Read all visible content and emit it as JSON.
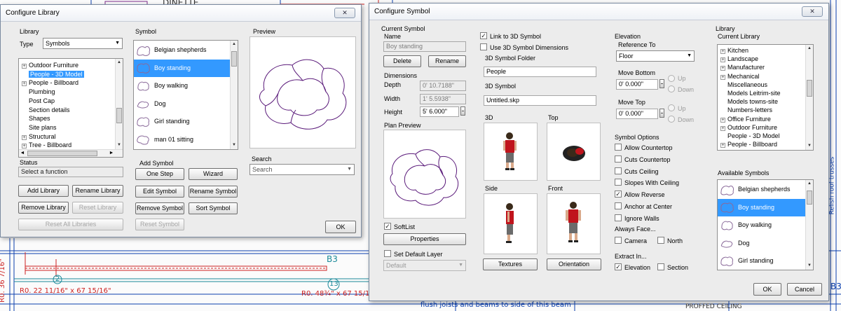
{
  "background": {
    "texts": [
      "DINETTE",
      "flush joists and beams to side of this beam",
      "PROFFED CEILING",
      "B3",
      "B3",
      "R0. 22 11/16\" x 67 15/16\"",
      "R0. 48¾\" x 67 15/16\"",
      "R0. 36 7/16\"",
      "2",
      "13",
      "Relish roof trusses"
    ]
  },
  "library_dialog": {
    "title": "Configure Library",
    "close_label": "✕",
    "library_group_label": "Library",
    "type_label": "Type",
    "type_value": "Symbols",
    "tree_items": [
      {
        "label": "Outdoor Furniture",
        "expander": "+",
        "selected": false
      },
      {
        "label": "People - 3D Model",
        "expander": "",
        "selected": true
      },
      {
        "label": "People - Billboard",
        "expander": "+",
        "selected": false
      },
      {
        "label": "Plumbing",
        "expander": "",
        "selected": false
      },
      {
        "label": "Post Cap",
        "expander": "",
        "selected": false
      },
      {
        "label": "Section details",
        "expander": "",
        "selected": false
      },
      {
        "label": "Shapes",
        "expander": "",
        "selected": false
      },
      {
        "label": "Site plans",
        "expander": "",
        "selected": false
      },
      {
        "label": "Structural",
        "expander": "+",
        "selected": false
      },
      {
        "label": "Tree - Billboard",
        "expander": "+",
        "selected": false
      }
    ],
    "status_label": "Status",
    "status_value": "Select a function",
    "add_library": "Add Library",
    "rename_library": "Rename Library",
    "remove_library": "Remove Library",
    "reset_library": "Reset Library",
    "reset_all_libraries": "Reset All Libraries",
    "symbol_group_label": "Symbol",
    "symbols": [
      "Belgian shepherds",
      "Boy standing",
      "Boy walking",
      "Dog",
      "Girl standing",
      "man 01 sitting"
    ],
    "selected_symbol_index": 1,
    "add_symbol_label": "Add Symbol",
    "one_step": "One Step",
    "wizard": "Wizard",
    "edit_symbol": "Edit Symbol",
    "rename_symbol": "Rename Symbol",
    "remove_symbol": "Remove Symbol",
    "sort_symbol": "Sort Symbol",
    "reset_symbol": "Reset Symbol",
    "preview_label": "Preview",
    "search_label": "Search",
    "search_value": "Search",
    "ok": "OK"
  },
  "symbol_dialog": {
    "title": "Configure Symbol",
    "close_label": "✕",
    "current_symbol_label": "Current Symbol",
    "name_label": "Name",
    "name_value": "Boy standing",
    "delete": "Delete",
    "rename": "Rename",
    "dimensions_label": "Dimensions",
    "depth_label": "Depth",
    "depth_value": "0' 10.7188\"",
    "width_label": "Width",
    "width_value": "1' 5.5938\"",
    "height_label": "Height",
    "height_value": "5' 6.000\"",
    "plan_preview_label": "Plan Preview",
    "softlist_label": "SoftList",
    "softlist_checked": true,
    "properties": "Properties",
    "set_default_layer_label": "Set Default Layer",
    "set_default_layer_checked": false,
    "layer_value": "Default",
    "link_3d_label": "Link to 3D Symbol",
    "link_3d_checked": true,
    "use_3d_dims_label": "Use 3D Symbol Dimensions",
    "use_3d_dims_checked": false,
    "folder_label": "3D Symbol Folder",
    "folder_value": "People",
    "symbol_3d_label": "3D Symbol",
    "symbol_3d_value": "Untitled.skp",
    "view_3d_label": "3D",
    "view_top_label": "Top",
    "view_side_label": "Side",
    "view_front_label": "Front",
    "textures": "Textures",
    "orientation": "Orientation",
    "elevation_label": "Elevation",
    "reference_to_label": "Reference To",
    "reference_value": "Floor",
    "move_bottom_label": "Move Bottom",
    "move_bottom_value": "0' 0.000\"",
    "move_top_label": "Move Top",
    "move_top_value": "0' 0.000\"",
    "up_label": "Up",
    "down_label": "Down",
    "symbol_options_label": "Symbol Options",
    "options": [
      {
        "label": "Allow Countertop",
        "checked": false
      },
      {
        "label": "Cuts Countertop",
        "checked": false
      },
      {
        "label": "Cuts Ceiling",
        "checked": false
      },
      {
        "label": "Slopes With Ceiling",
        "checked": false
      },
      {
        "label": "Allow Reverse",
        "checked": true
      },
      {
        "label": "Anchor at Center",
        "checked": false
      },
      {
        "label": "Ignore Walls",
        "checked": false
      }
    ],
    "always_face_label": "Always Face...",
    "camera_label": "Camera",
    "north_label": "North",
    "extract_in_label": "Extract In...",
    "elevation_chk_label": "Elevation",
    "section_chk_label": "Section",
    "library_label": "Library",
    "current_library_label": "Current Library",
    "library_tree": [
      {
        "label": "Kitchen",
        "expander": "+"
      },
      {
        "label": "Landscape",
        "expander": "+"
      },
      {
        "label": "Manufacturer",
        "expander": "+"
      },
      {
        "label": "Mechanical",
        "expander": "+"
      },
      {
        "label": "Miscellaneous",
        "expander": ""
      },
      {
        "label": "Models Leitrim-site",
        "expander": ""
      },
      {
        "label": "Models towns-site",
        "expander": ""
      },
      {
        "label": "Numbers-letters",
        "expander": ""
      },
      {
        "label": "Office Furniture",
        "expander": "+"
      },
      {
        "label": "Outdoor Furniture",
        "expander": "+"
      },
      {
        "label": "People - 3D Model",
        "expander": ""
      },
      {
        "label": "People - Billboard",
        "expander": "+"
      }
    ],
    "available_symbols_label": "Available Symbols",
    "available_symbols": [
      "Belgian shepherds",
      "Boy standing",
      "Boy walking",
      "Dog",
      "Girl standing"
    ],
    "selected_available_index": 1,
    "ok": "OK",
    "cancel": "Cancel"
  }
}
